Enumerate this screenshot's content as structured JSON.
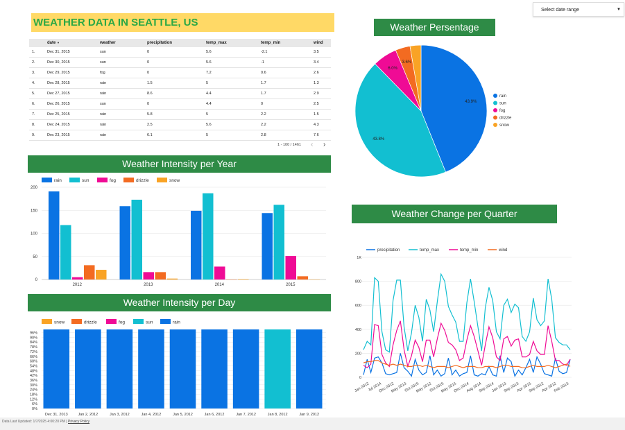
{
  "date_range": {
    "label": "Select date range"
  },
  "page_title": "WEATHER DATA IN SEATTLE, US",
  "table": {
    "headers": [
      "date",
      "weather",
      "precipitation",
      "temp_max",
      "temp_min",
      "wind"
    ],
    "sort_indicator": "▼",
    "rows": [
      [
        "1.",
        "Dec 31, 2015",
        "sun",
        "0",
        "5.6",
        "-2.1",
        "3.5"
      ],
      [
        "2.",
        "Dec 30, 2015",
        "sun",
        "0",
        "5.6",
        "-1",
        "3.4"
      ],
      [
        "3.",
        "Dec 29, 2015",
        "fog",
        "0",
        "7.2",
        "0.6",
        "2.6"
      ],
      [
        "4.",
        "Dec 28, 2015",
        "rain",
        "1.5",
        "5",
        "1.7",
        "1.3"
      ],
      [
        "5.",
        "Dec 27, 2015",
        "rain",
        "8.6",
        "4.4",
        "1.7",
        "2.9"
      ],
      [
        "6.",
        "Dec 26, 2015",
        "sun",
        "0",
        "4.4",
        "0",
        "2.5"
      ],
      [
        "7.",
        "Dec 25, 2015",
        "rain",
        "5.8",
        "5",
        "2.2",
        "1.5"
      ],
      [
        "8.",
        "Dec 24, 2015",
        "rain",
        "2.5",
        "5.6",
        "2.2",
        "4.3"
      ],
      [
        "9.",
        "Dec 23, 2015",
        "rain",
        "6.1",
        "5",
        "2.8",
        "7.6"
      ]
    ],
    "pagination": "1 - 100 / 1461"
  },
  "colors": {
    "rain": "#0a73e3",
    "sun": "#12bfd1",
    "fog": "#ef0b95",
    "drizzle": "#f36b21",
    "snow": "#f9a325",
    "header_green": "#2e8b46",
    "title_yellow": "#ffd966"
  },
  "chart_data": [
    {
      "type": "pie",
      "title": "Weather Persentage",
      "labels": [
        "rain",
        "sun",
        "fog",
        "drizzle",
        "snow"
      ],
      "values": [
        43.9,
        43.8,
        6.0,
        3.6,
        2.7
      ],
      "data_labels": [
        "43.9%",
        "43.8%",
        "6.0%",
        "3.6%",
        ""
      ],
      "legend": "right"
    },
    {
      "type": "bar",
      "title": "Weather Intensity per Year",
      "categories": [
        "2012",
        "2013",
        "2014",
        "2015"
      ],
      "series": [
        {
          "name": "rain",
          "values": [
            191,
            159,
            149,
            144
          ]
        },
        {
          "name": "sun",
          "values": [
            118,
            173,
            187,
            162
          ]
        },
        {
          "name": "fog",
          "values": [
            5,
            16,
            28,
            51
          ]
        },
        {
          "name": "drizzle",
          "values": [
            31,
            16,
            0,
            7
          ]
        },
        {
          "name": "snow",
          "values": [
            21,
            2,
            1,
            0
          ]
        }
      ],
      "yticks": [
        "0",
        "50",
        "100",
        "150",
        "200"
      ],
      "ylim": [
        0,
        200
      ],
      "legend": "top"
    },
    {
      "type": "bar",
      "title": "Weather Intensity per Day",
      "categories": [
        "Dec 31, 2013",
        "Jan 2, 2012",
        "Jan 3, 2012",
        "Jan 4, 2012",
        "Jan 5, 2012",
        "Jan 6, 2012",
        "Jan 7, 2012",
        "Jan 8, 2012",
        "Jan 9, 2012"
      ],
      "values": [
        100,
        100,
        100,
        100,
        100,
        100,
        100,
        100,
        100
      ],
      "bar_series": [
        "rain",
        "rain",
        "rain",
        "rain",
        "rain",
        "rain",
        "rain",
        "sun",
        "rain"
      ],
      "legend_series": [
        "snow",
        "drizzle",
        "fog",
        "sun",
        "rain"
      ],
      "yticks": [
        "96%",
        "90%",
        "84%",
        "78%",
        "72%",
        "66%",
        "60%",
        "54%",
        "48%",
        "42%",
        "36%",
        "30%",
        "24%",
        "18%",
        "12%",
        "6%",
        "0%"
      ],
      "ylim": [
        0,
        100
      ],
      "legend": "top"
    },
    {
      "type": "line",
      "title": "Weather Change per Quarter",
      "x": [
        "Jan 2012",
        "Jul 2014",
        "Dec 2012",
        "May 2013",
        "Oct 2015",
        "May 2012",
        "Oct 2015",
        "May 2015",
        "Dec 2014",
        "Aug 2014",
        "Sep 2014",
        "Jan 2013",
        "Sep 2013",
        "Apr 2015",
        "Sep 2012",
        "Apr 2012",
        "Feb 2013"
      ],
      "yticks": [
        "0",
        "200",
        "400",
        "600",
        "800",
        "1K"
      ],
      "ylim": [
        0,
        1000
      ],
      "series": [
        {
          "name": "precipitation",
          "values": [
            20,
            150,
            40,
            160,
            170,
            120,
            30,
            20,
            30,
            40,
            200,
            80,
            50,
            10,
            150,
            60,
            20,
            40,
            180,
            20,
            60,
            10,
            30,
            160,
            20,
            60,
            10,
            30,
            40,
            180,
            20,
            10,
            30,
            20,
            90,
            20,
            10,
            180,
            40,
            160,
            130,
            10,
            60,
            20,
            80,
            150,
            40,
            170,
            110,
            30,
            20,
            10,
            160,
            50,
            30,
            40,
            150
          ]
        },
        {
          "name": "temp_max",
          "values": [
            230,
            300,
            270,
            830,
            800,
            380,
            230,
            210,
            640,
            810,
            810,
            420,
            220,
            370,
            600,
            500,
            300,
            650,
            560,
            380,
            630,
            860,
            800,
            590,
            520,
            460,
            300,
            300,
            620,
            820,
            630,
            420,
            220,
            580,
            750,
            640,
            380,
            320,
            600,
            650,
            540,
            610,
            580,
            340,
            300,
            380,
            660,
            480,
            430,
            470,
            820,
            650,
            330,
            290,
            270,
            270,
            230
          ]
        },
        {
          "name": "temp_min",
          "values": [
            100,
            80,
            110,
            440,
            430,
            190,
            120,
            90,
            270,
            390,
            470,
            230,
            90,
            180,
            310,
            250,
            130,
            310,
            310,
            170,
            320,
            450,
            390,
            290,
            270,
            230,
            140,
            160,
            310,
            430,
            340,
            220,
            100,
            270,
            420,
            330,
            170,
            140,
            320,
            340,
            260,
            310,
            320,
            170,
            170,
            190,
            300,
            220,
            190,
            190,
            430,
            300,
            140,
            140,
            110,
            100,
            150
          ]
        },
        {
          "name": "wind",
          "values": [
            120,
            130,
            130,
            140,
            140,
            120,
            110,
            100,
            110,
            100,
            110,
            100,
            90,
            90,
            100,
            100,
            90,
            100,
            90,
            80,
            90,
            90,
            90,
            80,
            90,
            100,
            90,
            80,
            90,
            90,
            90,
            80,
            80,
            90,
            90,
            90,
            80,
            90,
            100,
            100,
            90,
            90,
            90,
            80,
            80,
            90,
            100,
            90,
            90,
            90,
            100,
            90,
            80,
            90,
            100,
            110,
            90
          ]
        }
      ],
      "legend": "top"
    }
  ],
  "footer": {
    "updated": "Data Last Updated: 1/7/2025 4:00:20 PM",
    "separator": "|",
    "privacy": "Privacy Policy"
  }
}
